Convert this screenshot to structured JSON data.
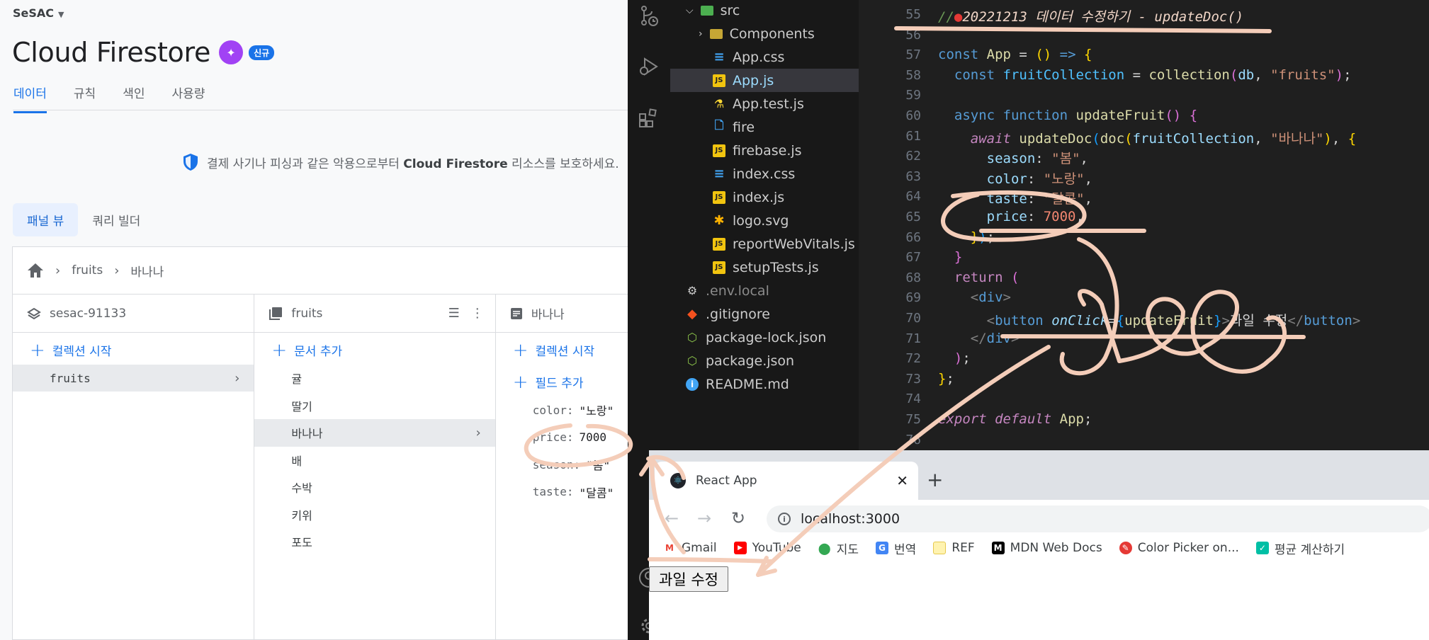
{
  "firebase": {
    "project": "SeSAC",
    "title": "Cloud Firestore",
    "new_badge": "신규",
    "tabs": [
      "데이터",
      "규칙",
      "색인",
      "사용량"
    ],
    "protect_text": "결제 사기나 피싱과 같은 악용으로부터",
    "protect_bold": "Cloud Firestore",
    "protect_tail": "리소스를 보호하세요.",
    "view_tabs": [
      "패널 뷰",
      "쿼리 빌더"
    ],
    "breadcrumb": [
      "fruits",
      "바나나"
    ],
    "col1": {
      "header": "sesac-91133",
      "add_label": "컬렉션 시작",
      "items": [
        "fruits"
      ]
    },
    "col2": {
      "header": "fruits",
      "add_label": "문서 추가",
      "items": [
        "귤",
        "딸기",
        "바나나",
        "배",
        "수박",
        "키위",
        "포도"
      ],
      "selected": "바나나"
    },
    "col3": {
      "header": "바나나",
      "add_collection": "컬렉션 시작",
      "add_field": "필드 추가",
      "fields": [
        {
          "key": "color:",
          "value": "\"노랑\""
        },
        {
          "key": "price:",
          "value": "7000"
        },
        {
          "key": "season:",
          "value": "\"봄\""
        },
        {
          "key": "taste:",
          "value": "\"달콤\""
        }
      ]
    }
  },
  "vscode": {
    "explorer": [
      {
        "name": "src",
        "type": "src"
      },
      {
        "name": "Components",
        "type": "folder"
      },
      {
        "name": "App.css",
        "type": "css"
      },
      {
        "name": "App.js",
        "type": "js",
        "selected": true
      },
      {
        "name": "App.test.js",
        "type": "test"
      },
      {
        "name": "fire",
        "type": "file"
      },
      {
        "name": "firebase.js",
        "type": "js"
      },
      {
        "name": "index.css",
        "type": "css"
      },
      {
        "name": "index.js",
        "type": "js"
      },
      {
        "name": "logo.svg",
        "type": "svg"
      },
      {
        "name": "reportWebVitals.js",
        "type": "js"
      },
      {
        "name": "setupTests.js",
        "type": "js"
      },
      {
        "name": ".env.local",
        "type": "env"
      },
      {
        "name": ".gitignore",
        "type": "git"
      },
      {
        "name": "package-lock.json",
        "type": "json"
      },
      {
        "name": "package.json",
        "type": "json"
      },
      {
        "name": "README.md",
        "type": "info"
      }
    ],
    "line_numbers": [
      "55",
      "56",
      "57",
      "58",
      "59",
      "60",
      "61",
      "62",
      "63",
      "64",
      "65",
      "66",
      "67",
      "68",
      "69",
      "70",
      "71",
      "72",
      "73",
      "74",
      "75",
      "76"
    ],
    "comment": "20221213 데이터 수정하기 - updateDoc()",
    "code": {
      "const": "const",
      "app": "App",
      "arrow": "=>",
      "fruitCollection": "fruitCollection",
      "collection": "collection",
      "db": "db",
      "fruits_str": "\"fruits\"",
      "async": "async",
      "function": "function",
      "updateFruit": "updateFruit",
      "await": "await",
      "updateDoc": "updateDoc",
      "doc": "doc",
      "banana_str": "\"바나나\"",
      "season_key": "season",
      "season_val": "\"봄\"",
      "color_key": "color",
      "color_val": "\"노랑\"",
      "taste_key": "taste",
      "taste_val": "\"달콤\"",
      "price_key": "price",
      "price_val": "7000",
      "return": "return",
      "div": "div",
      "button": "button",
      "onClick": "onClick",
      "btn_text": "과일 수정",
      "export": "export",
      "default": "default"
    }
  },
  "browser": {
    "tab_title": "React App",
    "url": "localhost:3000",
    "bookmarks": [
      "Gmail",
      "YouTube",
      "지도",
      "번역",
      "REF",
      "MDN Web Docs",
      "Color Picker on...",
      "평균 계산하기"
    ],
    "page_button": "과일 수정"
  },
  "colors": {
    "firebase_blue": "#1a73e8",
    "vscode_bg": "#1e1e1e",
    "ink": "#f4cdb9"
  }
}
